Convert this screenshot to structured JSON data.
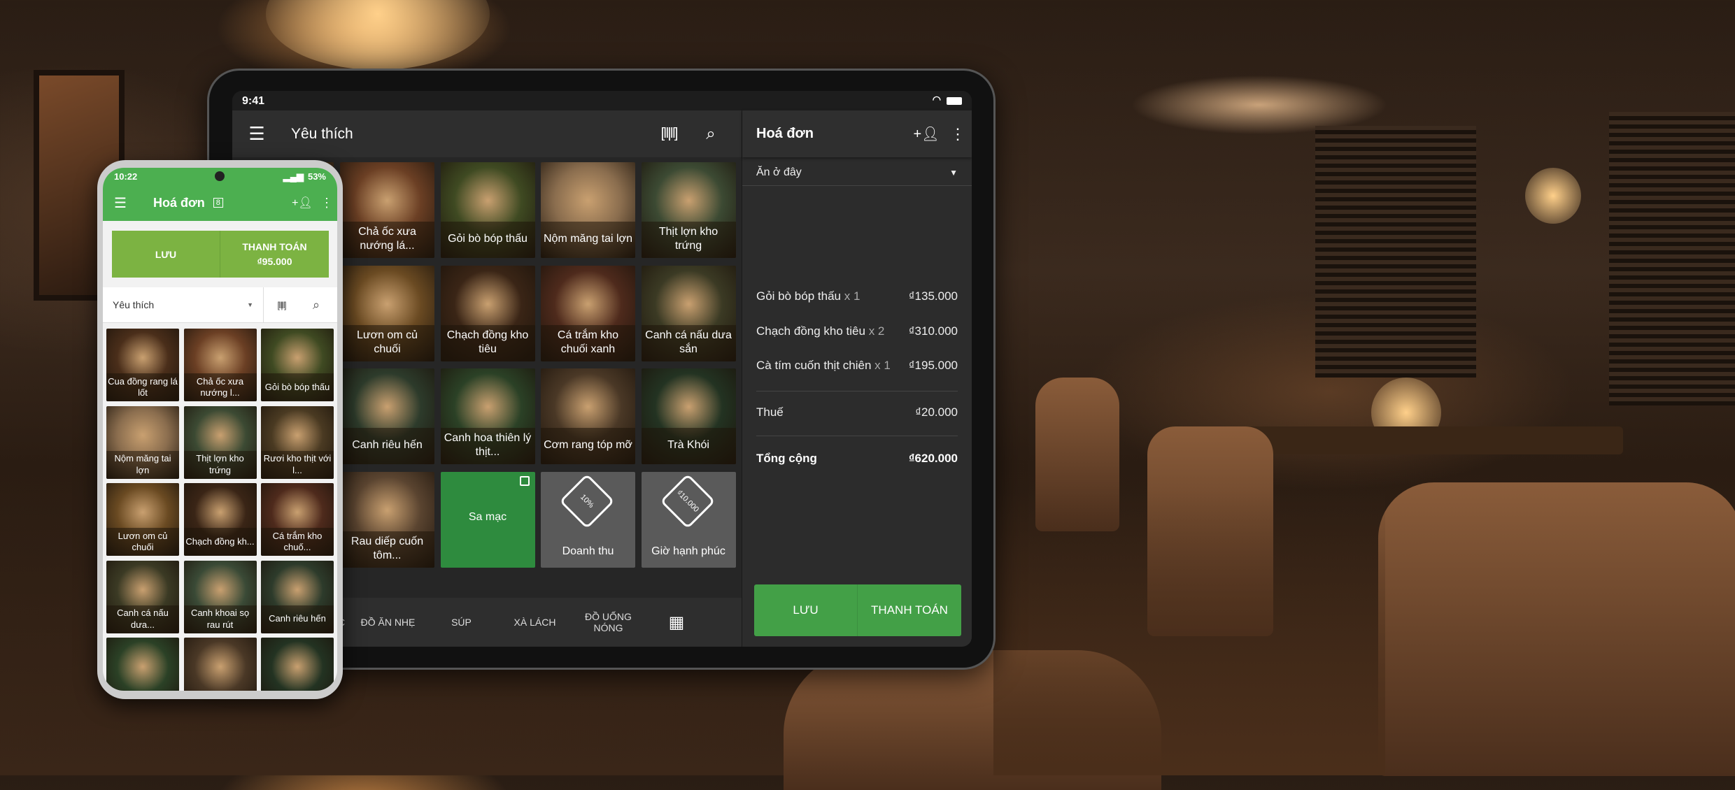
{
  "tablet": {
    "status_time": "9:41",
    "toolbar": {
      "title": "Yêu thích",
      "menu_icon": "menu-icon",
      "barcode_icon": "barcode-icon",
      "search_icon": "search-icon"
    },
    "grid": [
      {
        "label": "Chả ốc xưa nướng lá...",
        "type": "photo",
        "color": "#6b3f24"
      },
      {
        "label": "Gỏi bò bóp thấu",
        "type": "photo",
        "color": "#3f4a22"
      },
      {
        "label": "Nộm măng tai lợn",
        "type": "photo",
        "color": "#8a6d4e"
      },
      {
        "label": "Thịt lợn kho trứng",
        "type": "photo",
        "color": "#3c4a33"
      },
      {
        "label": "Lươn om củ chuối",
        "type": "photo",
        "color": "#6a4a22"
      },
      {
        "label": "Chạch đồng kho tiêu",
        "type": "photo",
        "color": "#3a2516"
      },
      {
        "label": "Cá trắm kho chuối xanh",
        "type": "photo",
        "color": "#4e2a1c"
      },
      {
        "label": "Canh cá nấu dưa sắn",
        "type": "photo",
        "color": "#3b3a24"
      },
      {
        "label": "Canh riêu hến",
        "type": "photo",
        "color": "#2d3b2b"
      },
      {
        "label": "Canh hoa thiên lý thịt...",
        "type": "photo",
        "color": "#2b4126"
      },
      {
        "label": "Cơm rang tóp mỡ",
        "type": "photo",
        "color": "#4a3826"
      },
      {
        "label": "Trà Khói",
        "type": "photo",
        "color": "#233322"
      },
      {
        "label": "Rau diếp cuốn tôm...",
        "type": "photo",
        "color": "#5a4430"
      },
      {
        "label": "Sa mạc",
        "type": "folder",
        "color": "#2e8b3e"
      },
      {
        "label": "Doanh thu",
        "type": "discount",
        "tag": "10%",
        "color": "#5a5a5a"
      },
      {
        "label": "Giờ hạnh phúc",
        "type": "discount",
        "tag": "₫10.000",
        "color": "#5a5a5a"
      }
    ],
    "categories": [
      "MẠC",
      "ĐỒ ĂN NHẸ",
      "SÚP",
      "XÀ LÁCH",
      "ĐỒ UỐNG NÓNG"
    ],
    "categories_grid_icon": "grid-icon",
    "receipt": {
      "title": "Hoá đơn",
      "dining_option": "Ăn ở đây",
      "items": [
        {
          "name": "Gỏi bò bóp thấu",
          "qty": "x 1",
          "price": "₫135.000"
        },
        {
          "name": "Chạch đồng kho tiêu",
          "qty": "x 2",
          "price": "₫310.000"
        },
        {
          "name": "Cà tím cuốn thịt chiên",
          "qty": "x 1",
          "price": "₫195.000"
        }
      ],
      "tax_label": "Thuế",
      "tax": "₫20.000",
      "total_label": "Tổng cộng",
      "total": "₫620.000",
      "save_label": "LƯU",
      "charge_label": "THANH TOÁN"
    }
  },
  "phone": {
    "status_time": "10:22",
    "battery": "53%",
    "toolbar": {
      "title": "Hoá đơn",
      "badge": "8"
    },
    "save_label": "LƯU",
    "charge_label": "THANH TOÁN",
    "charge_amount": "₫95.000",
    "category": "Yêu thích",
    "grid": [
      {
        "label": "Cua đồng rang lá lốt",
        "color": "#4a2e1a"
      },
      {
        "label": "Chả ốc xưa nướng l...",
        "color": "#6b3f24"
      },
      {
        "label": "Gỏi bò bóp thấu",
        "color": "#3f4a22"
      },
      {
        "label": "Nộm măng tai lợn",
        "color": "#8a6d4e"
      },
      {
        "label": "Thịt lợn kho trứng",
        "color": "#3c4a33"
      },
      {
        "label": "Rươi kho thịt với l...",
        "color": "#4a3a22"
      },
      {
        "label": "Lươn om củ chuối",
        "color": "#6a4a22"
      },
      {
        "label": "Chạch đồng kh...",
        "color": "#3a2516"
      },
      {
        "label": "Cá trắm kho chuố...",
        "color": "#4e2a1c"
      },
      {
        "label": "Canh cá nấu dưa...",
        "color": "#3b3a24"
      },
      {
        "label": "Canh khoai sọ rau rút",
        "color": "#3a4a36"
      },
      {
        "label": "Canh riêu hến",
        "color": "#2d3b2b"
      },
      {
        "label": "",
        "color": "#2b4126"
      },
      {
        "label": "",
        "color": "#4a3826"
      },
      {
        "label": "",
        "color": "#233322"
      }
    ]
  }
}
